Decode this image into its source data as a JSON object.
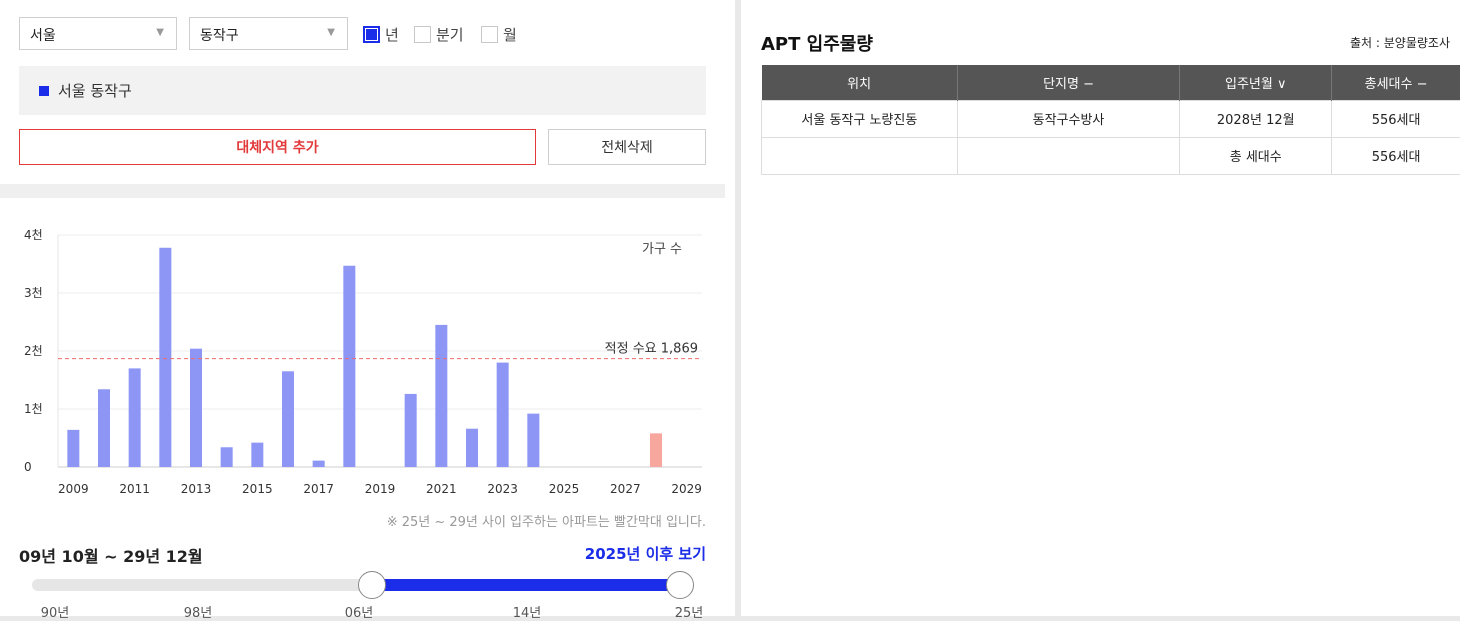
{
  "filters": {
    "city": "서울",
    "district": "동작구",
    "period_options": [
      {
        "label": "년",
        "checked": true
      },
      {
        "label": "분기",
        "checked": false
      },
      {
        "label": "월",
        "checked": false
      }
    ]
  },
  "region_tag": "서울 동작구",
  "buttons": {
    "add_region": "대체지역 추가",
    "delete_all": "전체삭제"
  },
  "chart_data": {
    "type": "bar",
    "legend_label": "가구 수",
    "y_ticks": [
      "0",
      "1천",
      "2천",
      "3천",
      "4천"
    ],
    "ylim": [
      0,
      4000
    ],
    "x_tick_labels": [
      "2009",
      "2011",
      "2013",
      "2015",
      "2017",
      "2019",
      "2021",
      "2023",
      "2025",
      "2027",
      "2029"
    ],
    "categories": [
      2009,
      2010,
      2011,
      2012,
      2013,
      2014,
      2015,
      2016,
      2017,
      2018,
      2019,
      2020,
      2021,
      2022,
      2023,
      2024,
      2025,
      2026,
      2027,
      2028,
      2029
    ],
    "values": [
      640,
      1340,
      1700,
      3780,
      2040,
      340,
      420,
      1650,
      110,
      3470,
      0,
      1260,
      2450,
      660,
      1800,
      920,
      0,
      0,
      0,
      580,
      0
    ],
    "highlight_color": "#f7a79d",
    "bar_color": "#8d95f5",
    "highlight_from": 2025,
    "reference_line": {
      "label": "적정 수요 1,869",
      "value": 1869,
      "color": "#ef6b6b"
    }
  },
  "chart_note": "※ 25년 ~ 29년 사이 입주하는 아파트는 빨간막대 입니다.",
  "range": {
    "label": "09년 10월 ~ 29년 12월",
    "after_link": "2025년 이후 보기",
    "ticks": [
      "90년",
      "98년",
      "06년",
      "14년",
      "25년"
    ]
  },
  "panel": {
    "title": "APT 입주물량",
    "source": "출처 : 분양물량조사",
    "columns": [
      "위치",
      "단지명 −",
      "입주년월 ∨",
      "총세대수 −"
    ],
    "rows": [
      [
        "서울 동작구 노량진동",
        "동작구수방사",
        "2028년 12월",
        "556세대"
      ],
      [
        "",
        "",
        "총 세대수",
        "556세대"
      ]
    ]
  }
}
